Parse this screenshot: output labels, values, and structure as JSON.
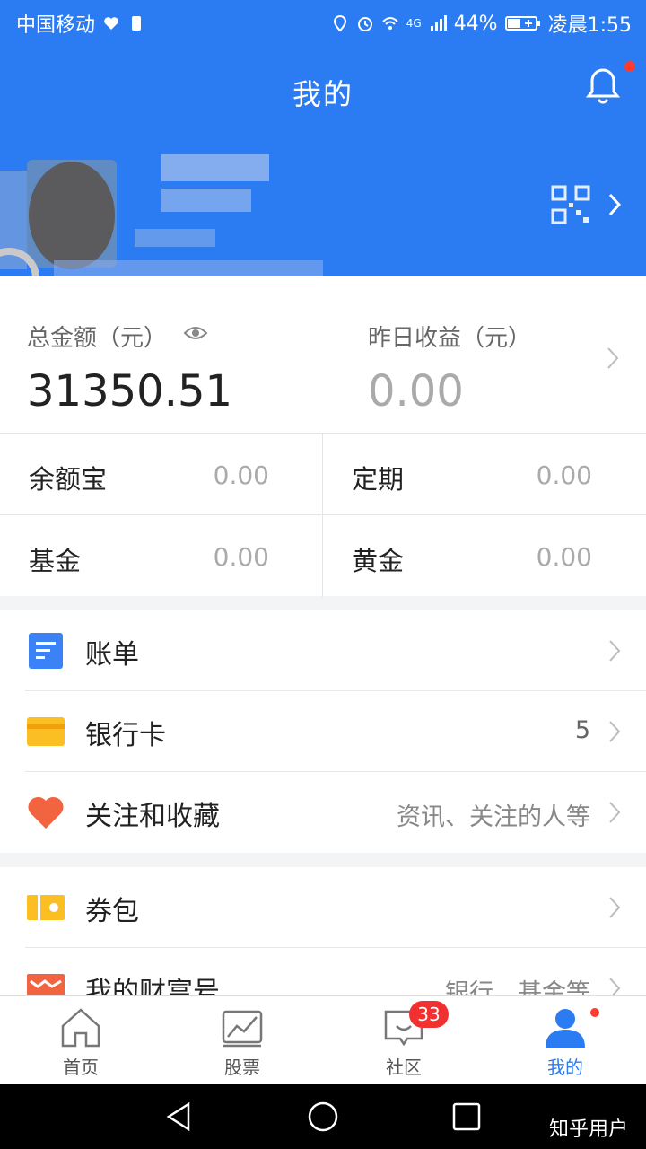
{
  "status_bar": {
    "carrier": "中国移动",
    "network": "4G",
    "battery": "44%",
    "time": "凌晨1:55"
  },
  "header": {
    "title": "我的"
  },
  "summary": {
    "total_label": "总金额（元）",
    "total_value": "31350.51",
    "yesterday_label": "昨日收益（元）",
    "yesterday_value": "0.00"
  },
  "assets": [
    {
      "label": "余额宝",
      "value": "0.00"
    },
    {
      "label": "定期",
      "value": "0.00"
    },
    {
      "label": "基金",
      "value": "0.00"
    },
    {
      "label": "黄金",
      "value": "0.00"
    }
  ],
  "list1": [
    {
      "label": "账单",
      "extra": ""
    },
    {
      "label": "银行卡",
      "extra": "5"
    },
    {
      "label": "关注和收藏",
      "extra": "资讯、关注的人等"
    }
  ],
  "list2": [
    {
      "label": "券包",
      "extra": ""
    },
    {
      "label": "我的财富号",
      "extra": "银行、基金等"
    }
  ],
  "bottom_nav": [
    {
      "label": "首页"
    },
    {
      "label": "股票"
    },
    {
      "label": "社区",
      "badge": "33"
    },
    {
      "label": "我的"
    }
  ],
  "watermark": "知乎用户",
  "colors": {
    "brand": "#2b7cf3",
    "badge": "#f23030"
  }
}
